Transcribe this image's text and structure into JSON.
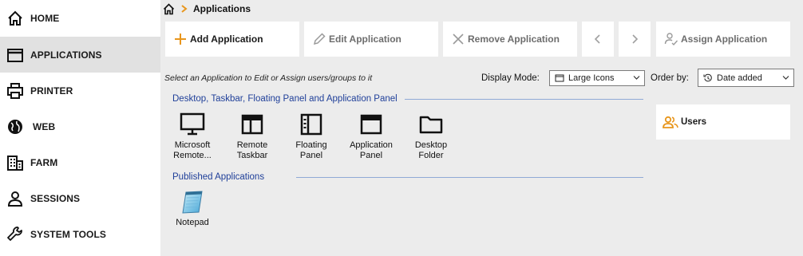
{
  "sidebar": {
    "items": [
      {
        "label": "HOME",
        "icon": "home-icon"
      },
      {
        "label": "APPLICATIONS",
        "icon": "window-icon",
        "active": true
      },
      {
        "label": "PRINTER",
        "icon": "printer-icon"
      },
      {
        "label": "WEB",
        "icon": "globe-icon"
      },
      {
        "label": "FARM",
        "icon": "building-icon"
      },
      {
        "label": "SESSIONS",
        "icon": "person-icon"
      },
      {
        "label": "SYSTEM TOOLS",
        "icon": "wrench-icon"
      }
    ]
  },
  "breadcrumb": {
    "title": "Applications"
  },
  "toolbar": {
    "add": "Add Application",
    "edit": "Edit Application",
    "remove": "Remove Application",
    "assign": "Assign Application"
  },
  "hint": "Select an Application to Edit or Assign users/groups to it",
  "display_mode": {
    "label": "Display Mode:",
    "value": "Large Icons"
  },
  "order_by": {
    "label": "Order by:",
    "value": "Date added"
  },
  "groups": {
    "desktop": {
      "title": "Desktop, Taskbar, Floating Panel and Application Panel",
      "items": [
        {
          "line1": "Microsoft",
          "line2": "Remote..."
        },
        {
          "line1": "Remote",
          "line2": "Taskbar"
        },
        {
          "line1": "Floating",
          "line2": "Panel"
        },
        {
          "line1": "Application",
          "line2": "Panel"
        },
        {
          "line1": "Desktop",
          "line2": "Folder"
        }
      ]
    },
    "published": {
      "title": "Published Applications",
      "items": [
        {
          "line1": "Notepad"
        }
      ]
    }
  },
  "users_panel": {
    "label": "Users"
  },
  "colors": {
    "accent_orange": "#e8961c",
    "group_title_blue": "#1f3f99",
    "active_nav_bg": "#e1e1e1"
  }
}
